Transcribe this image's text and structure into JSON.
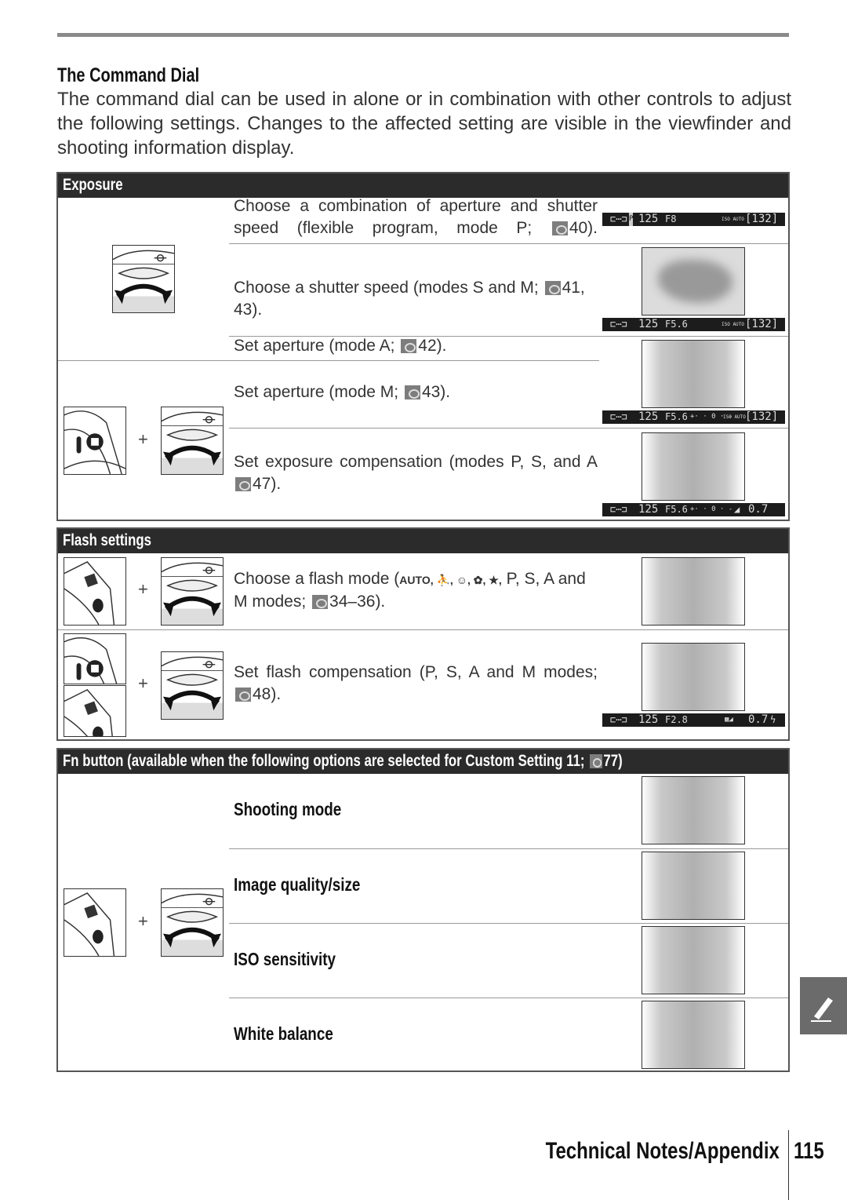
{
  "section_title": "The Command Dial",
  "intro": "The command dial can be used in alone or in combination with other controls to adjust the following settings.  Changes to the affected setting are visible in the viewfinder and shooting information display.",
  "exposure": {
    "header": "Exposure",
    "rows": [
      {
        "text": "Choose a combination of aperture and shutter speed (flexible program, mode P;",
        "ref": "40)."
      },
      {
        "text": "Choose a shutter speed (modes S and M;",
        "ref": "41, 43)."
      },
      {
        "text": "Set aperture (mode A;",
        "ref": "42)."
      },
      {
        "text": "Set aperture (mode M;",
        "ref": "43)."
      },
      {
        "text": "Set exposure compensation (modes P, S, and A",
        "ref": "47)."
      }
    ],
    "strips": [
      {
        "mode": "P",
        "shutter": "125",
        "aperture": "F8",
        "iso": "ISO AUTO",
        "count": "[132]"
      },
      {
        "shutter": "125",
        "aperture": "F5.6",
        "iso": "ISO AUTO",
        "count": "[132]"
      },
      {
        "shutter": "125",
        "aperture": "F5.6",
        "meter": "+· · 0 · -",
        "iso": "ISO AUTO",
        "count": "[132]"
      },
      {
        "shutter": "125",
        "aperture": "F5.6",
        "meter": "+· · 0 · -",
        "comp": "0.7"
      }
    ]
  },
  "flash": {
    "header": "Flash settings",
    "rows": [
      {
        "text": "Choose a flash mode (",
        "icons": "AUTO, ⛹, ☺, ✿, ★,",
        "text2": "P, S, A and M modes;",
        "ref": "34–36)."
      },
      {
        "text": "Set flash compensation (P, S, A and M modes;",
        "ref": "48)."
      }
    ],
    "strip": {
      "shutter": "125",
      "aperture": "F2.8",
      "comp": "0.7"
    }
  },
  "fn": {
    "header": "Fn button (available when the following options are selected for Custom Setting 11;",
    "ref": "77)",
    "items": [
      "Shooting mode",
      "Image quality/size",
      "ISO sensitivity",
      "White balance"
    ]
  },
  "footer": {
    "section": "Technical Notes/Appendix",
    "page": "115"
  }
}
